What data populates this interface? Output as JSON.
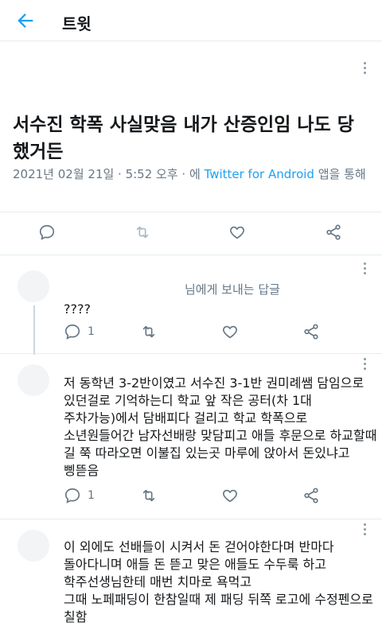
{
  "header": {
    "title": "트윗"
  },
  "tweet": {
    "text": "서수진 학폭 사실맞음 내가 산증인임 나도 당했거든",
    "date_time": "2021년 02월 21일 · 5:52 오후 · 에 ",
    "source": "Twitter for Android",
    "suffix": " 앱을 통해"
  },
  "replies": [
    {
      "reply_to": "님에게 보내는 답글",
      "text": "????",
      "reply_count": "1"
    },
    {
      "text_lines": [
        "저 동학년 3-2반이였고 서수진 3-1반 권미례쌤 담임으로",
        "있던걸로 기억하는디 학교 앞 작은 공터(차 1대",
        "주차가능)에서 담배피다 걸리고 학교 학폭으로",
        "소년원들어간 남자선배랑 맞담피고 애들 후문으로 하교할때",
        "길 쭉 따라오면 이불집 있는곳 마루에 앉아서 돈있냐고",
        "삥뜯음"
      ],
      "reply_count": "1"
    },
    {
      "text_lines": [
        "이 외에도 선배들이 시켜서 돈 걷어야한다며 반마다",
        "돌아다니며 애들 돈 뜯고 맞은 애들도 수두룩 하고",
        "학주선생님한테 매번 치마로 욕먹고",
        "그때 노페패딩이 한참일때 제 패딩 뒤쪽 로고에 수정펜으로",
        "칠함"
      ]
    }
  ],
  "icons": {
    "back": "back-arrow-icon",
    "more": "more-vertical-icon",
    "reply": "reply-icon",
    "retweet": "retweet-icon",
    "like": "like-icon",
    "share": "share-icon"
  },
  "colors": {
    "accent": "#1da1f2",
    "text": "#14171a",
    "secondary": "#657786"
  }
}
